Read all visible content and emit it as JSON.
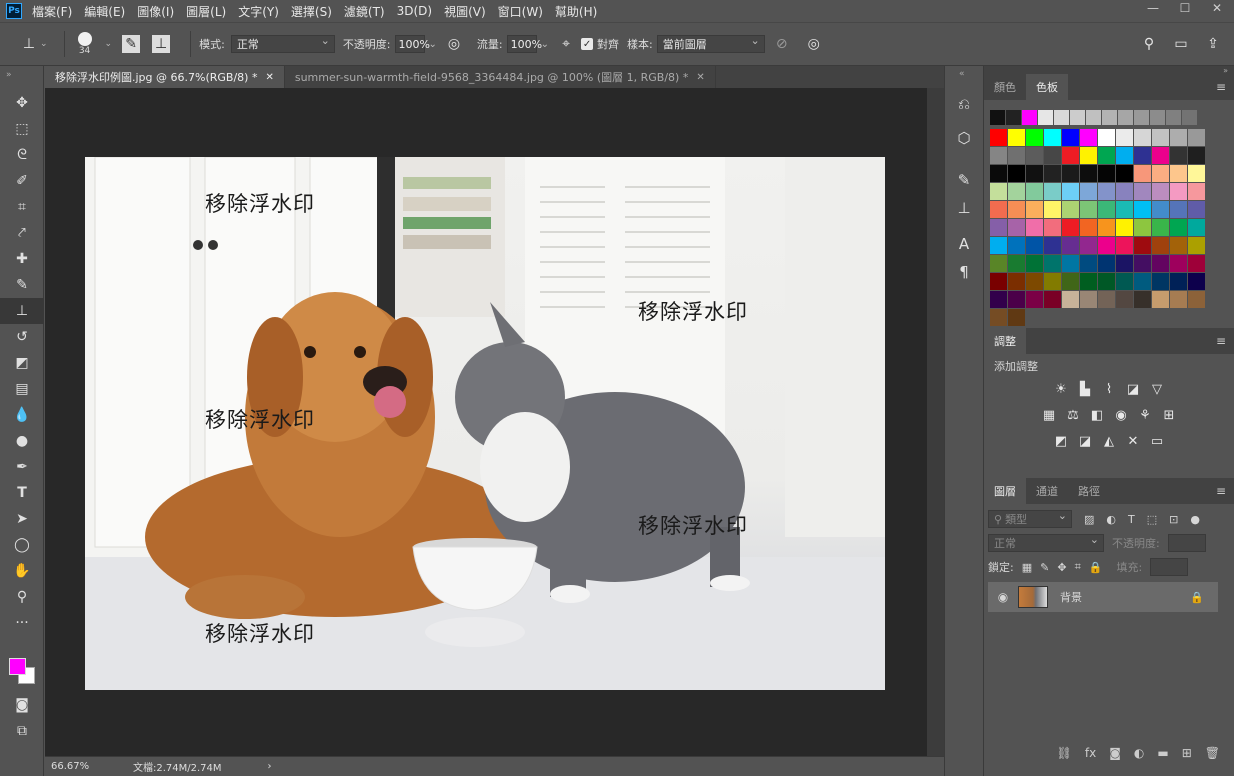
{
  "app": {
    "logo_text": "Ps"
  },
  "menu": [
    "檔案(F)",
    "編輯(E)",
    "圖像(I)",
    "圖層(L)",
    "文字(Y)",
    "選擇(S)",
    "濾鏡(T)",
    "3D(D)",
    "視圖(V)",
    "窗口(W)",
    "幫助(H)"
  ],
  "options": {
    "brush_size": "34",
    "mode_label": "模式:",
    "mode_value": "正常",
    "opacity_label": "不透明度:",
    "opacity_value": "100%",
    "flow_label": "流量:",
    "flow_value": "100%",
    "aligned_label": "對齊",
    "sample_label": "樣本:",
    "sample_value": "當前圖層"
  },
  "tabs": [
    {
      "label": "移除浮水印例圖.jpg @ 66.7%(RGB/8) *",
      "active": true
    },
    {
      "label": "summer-sun-warmth-field-9568_3364484.jpg @ 100% (圖層 1, RGB/8) *",
      "active": false
    }
  ],
  "canvas": {
    "watermark_text": "移除浮水印"
  },
  "colors": {
    "foreground": "#ff00ff",
    "background": "#ffffff"
  },
  "status": {
    "zoom": "66.67%",
    "doc_info": "文檔:2.74M/2.74M"
  },
  "swatches_panel": {
    "tabs": [
      "顏色",
      "色板"
    ],
    "active_tab": "色板"
  },
  "adjustments_panel": {
    "title": "調整",
    "add_label": "添加調整"
  },
  "layers_panel": {
    "tabs": [
      "圖層",
      "通道",
      "路徑"
    ],
    "filter_label": "類型",
    "blend_mode": "正常",
    "opacity_label": "不透明度:",
    "lock_label": "鎖定:",
    "fill_label": "填充:",
    "layer_name": "背景"
  }
}
